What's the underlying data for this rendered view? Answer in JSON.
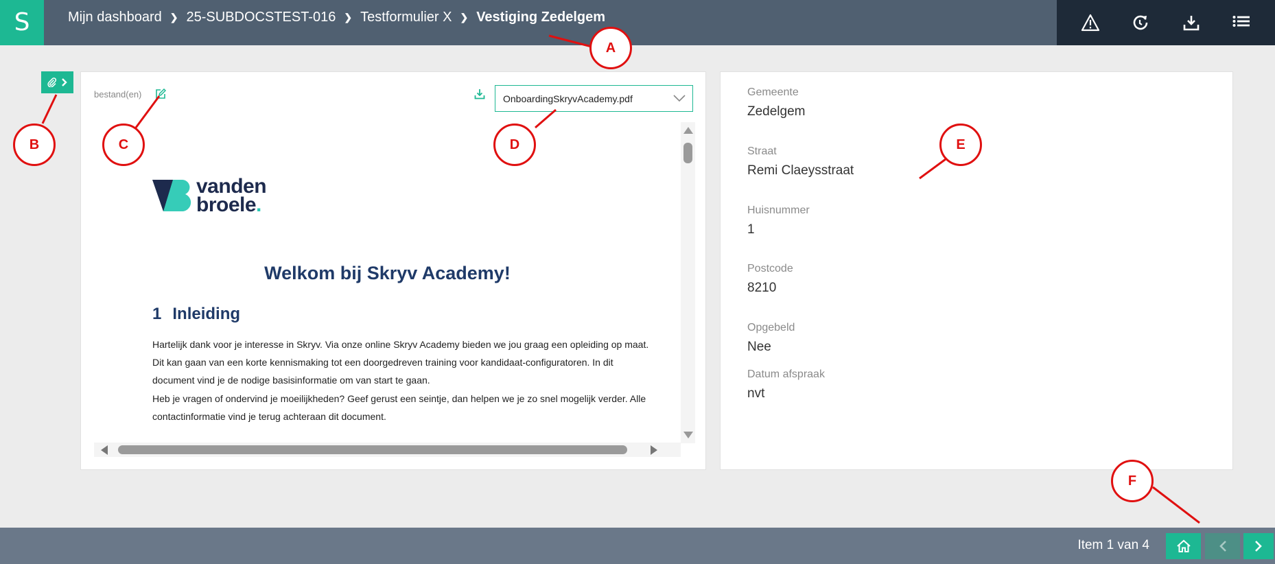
{
  "logo": {
    "letter": "S"
  },
  "breadcrumb": {
    "items": [
      "Mijn dashboard",
      "25-SUBDOCSTEST-016",
      "Testformulier X"
    ],
    "current": "Vestiging Zedelgem"
  },
  "toolbar": {
    "icons": [
      "warning-icon",
      "refresh-icon",
      "download-icon",
      "menu-icon"
    ]
  },
  "attachments": {
    "files_label": "bestand(en)",
    "selected_file": "OnboardingSkryvAcademy.pdf"
  },
  "document": {
    "logo_line1": "vanden",
    "logo_line2": "broele",
    "logo_dot": ".",
    "title": "Welkom bij Skryv Academy!",
    "section_number": "1",
    "section_title": "Inleiding",
    "paragraph1": "Hartelijk dank voor je interesse in Skryv. Via onze online Skryv Academy bieden we jou graag een opleiding op maat. Dit kan gaan van een korte kennismaking tot een doorgedreven training voor kandidaat-configuratoren. In dit document vind je de nodige basisinformatie om van start te gaan.",
    "paragraph2": "Heb je vragen of ondervind je moeilijkheden? Geef gerust een seintje, dan helpen we je zo snel mogelijk verder. Alle contactinformatie vind je terug achteraan dit document."
  },
  "fields": [
    {
      "label": "Gemeente",
      "value": "Zedelgem"
    },
    {
      "label": "Straat",
      "value": "Remi Claeysstraat"
    },
    {
      "label": "Huisnummer",
      "value": "1"
    },
    {
      "label": "Postcode",
      "value": "8210"
    },
    {
      "label": "Opgebeld",
      "value": "Nee"
    },
    {
      "label": "Datum afspraak",
      "value": "nvt"
    }
  ],
  "pagination": {
    "text": "Item 1 van 4"
  },
  "annotations": [
    "A",
    "B",
    "C",
    "D",
    "E",
    "F"
  ],
  "colors": {
    "accent": "#1db893",
    "topbar": "#506071",
    "topbar_dark": "#1e2a38",
    "bottombar": "#6a7889",
    "annotation": "#e01010",
    "doc_heading": "#1f3a68"
  }
}
